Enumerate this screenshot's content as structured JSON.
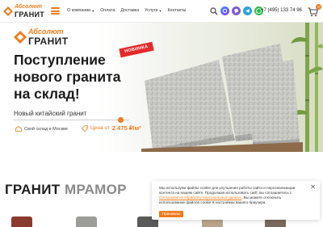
{
  "header": {
    "logo_line1": "Абсолют",
    "logo_line2": "ГРАНИТ",
    "nav": [
      {
        "label": "О компании",
        "has_dropdown": true
      },
      {
        "label": "Оплата",
        "has_dropdown": false
      },
      {
        "label": "Доставка",
        "has_dropdown": false
      },
      {
        "label": "Услуги",
        "has_dropdown": true
      },
      {
        "label": "Контакты",
        "has_dropdown": false
      }
    ],
    "phone": "+7 (495) 133 74 96",
    "cart_count": "0",
    "icons": [
      "search-icon",
      "max-messenger-icon",
      "viber-icon",
      "telegram-icon",
      "whatsapp-icon"
    ],
    "accent": "#f07c1e"
  },
  "hero": {
    "logo_line1": "Абсолют",
    "logo_line2": "ГРАНИТ",
    "title_line1": "Поступление",
    "title_line2": "нового гранита",
    "title_line3": "на склад!",
    "badge": "НОВИНКА",
    "subtitle": "Новый китайский гранит",
    "feature_stock": "Свой склад в Москве",
    "price_label": "Цена от",
    "price_value": "2 475 ₽/м²"
  },
  "categories": {
    "granite": "ГРАНИТ",
    "marble": "МРАМОР",
    "tile_colors": [
      "#8b3a2e",
      "#9c9c98",
      "#5a5a5a",
      "#b9a48b",
      "#7a6a5c"
    ]
  },
  "cookie": {
    "text_part1": "Мы используем файлы cookie для улучшения работы сайта и персонализации контента на нашем сайте. Продолжая использовать сайт, вы соглашаетесь с",
    "link_text": "Согласием на обработку персональных данных",
    "text_part2": ". Вы можете отключить использование файлов cookie в настройках вашего браузера.",
    "accept_label": "Принимаю",
    "close_symbol": "✕"
  }
}
